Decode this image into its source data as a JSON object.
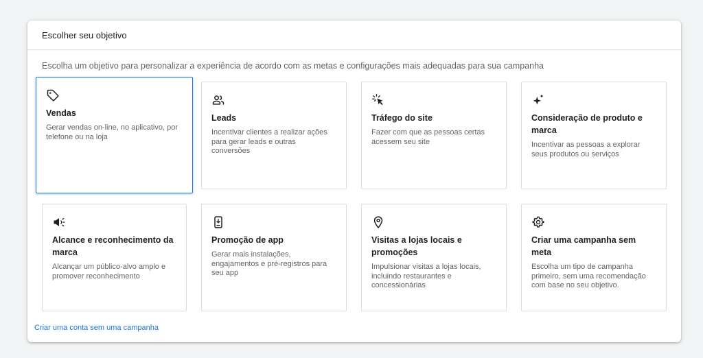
{
  "panel": {
    "title": "Escolher seu objetivo",
    "subtitle": "Escolha um objetivo para personalizar a experiência de acordo com as metas e configurações mais adequadas para sua campanha",
    "accent_color": "#1a73e8"
  },
  "objectives": [
    {
      "icon": "tag-icon",
      "title": "Vendas",
      "description": "Gerar vendas on-line, no aplicativo, por telefone ou na loja",
      "selected": true
    },
    {
      "icon": "people-icon",
      "title": "Leads",
      "description": "Incentivar clientes a realizar ações para gerar leads e outras conversões",
      "selected": false
    },
    {
      "icon": "cursor-click-icon",
      "title": "Tráfego do site",
      "description": "Fazer com que as pessoas certas acessem seu site",
      "selected": false
    },
    {
      "icon": "sparkle-icon",
      "title": "Consideração de produto e marca",
      "description": "Incentivar as pessoas a explorar seus produtos ou serviços",
      "selected": false
    },
    {
      "icon": "megaphone-icon",
      "title": "Alcance e reconhecimento da marca",
      "description": "Alcançar um público-alvo amplo e promover reconhecimento",
      "selected": false
    },
    {
      "icon": "phone-download-icon",
      "title": "Promoção de app",
      "description": "Gerar mais instalações, engajamentos e pré-registros para seu app",
      "selected": false
    },
    {
      "icon": "location-pin-icon",
      "title": "Visitas a lojas locais e promoções",
      "description": "Impulsionar visitas a lojas locais, incluindo restaurantes e concessionárias",
      "selected": false
    },
    {
      "icon": "gear-icon",
      "title": "Criar uma campanha sem meta",
      "description": "Escolha um tipo de campanha primeiro, sem uma recomendação com base no seu objetivo.",
      "selected": false
    }
  ],
  "footer": {
    "link_label": "Criar uma conta sem uma campanha"
  }
}
